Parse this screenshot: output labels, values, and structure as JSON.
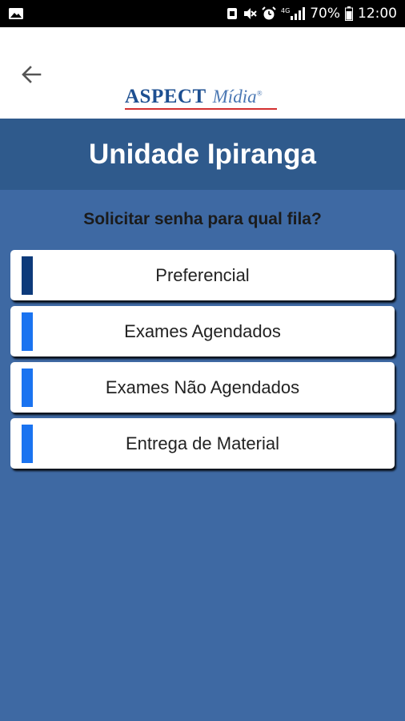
{
  "status_bar": {
    "battery_percent": "70%",
    "time": "12:00",
    "network": "4G"
  },
  "app_bar": {
    "back_icon": "arrow-left-icon",
    "logo_main": "ASPECT",
    "logo_sub": "Mídia",
    "logo_reg": "®"
  },
  "header": {
    "title": "Unidade Ipiranga"
  },
  "prompt": "Solicitar senha para qual fila?",
  "queues": [
    {
      "label": "Preferencial",
      "color": "#0d3a7a"
    },
    {
      "label": "Exames Agendados",
      "color": "#1a73f0"
    },
    {
      "label": "Exames Não Agendados",
      "color": "#1a73f0"
    },
    {
      "label": "Entrega de Material",
      "color": "#1a73f0"
    }
  ],
  "colors": {
    "background": "#3e69a3",
    "header": "#2f5a8c",
    "logo_blue": "#1d4f91",
    "logo_red": "#d32f2f"
  }
}
